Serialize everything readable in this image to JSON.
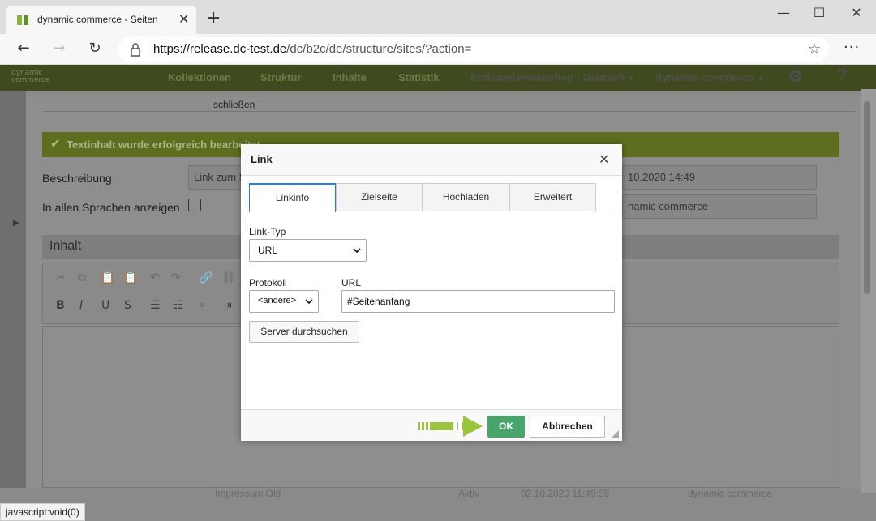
{
  "browser": {
    "tab_title": "dynamic commerce - Seiten",
    "close_glyph": "✕",
    "new_tab_glyph": "+",
    "url_host": "https://release.dc-test.de",
    "url_path": "/dc/b2c/de/structure/sites/?action=",
    "minimize_glyph": "—",
    "maximize_glyph": "☐",
    "close_window_glyph": "✕",
    "back_glyph": "←",
    "forward_glyph": "→",
    "reload_glyph": "↻",
    "star_glyph": "☆",
    "menu_glyph": "···"
  },
  "app_nav": {
    "logo_line1": "dynamic",
    "logo_line2": "commerce",
    "items": [
      "Kollektionen",
      "Struktur",
      "Inhalte",
      "Statistik"
    ],
    "shop_select": "Endkundenwebshop - Deutsch",
    "user_select": "dynamic commerce",
    "dropdown_glyph": "▼",
    "gear_glyph": "⚙",
    "help_glyph": "?"
  },
  "background_form": {
    "close_link": "schließen",
    "success_message": "Textinhalt wurde erfolgreich bearbeitet",
    "check_glyph": "✔",
    "description_label": "Beschreibung",
    "description_value": "Link zum S",
    "all_languages_label": "In allen Sprachen anzeigen",
    "date_value": "10.2020 14:49",
    "company_value": "namic commerce",
    "content_header": "Inhalt",
    "bottom_row": {
      "name": "Impressum Old",
      "status": "Aktiv",
      "date": "02.10.2020 11:49:59",
      "owner": "dynamic commerce"
    }
  },
  "status_bar": "javascript:void(0)",
  "dialog": {
    "title": "Link",
    "close_glyph": "✕",
    "tabs": [
      "Linkinfo",
      "Zielseite",
      "Hochladen",
      "Erweitert"
    ],
    "link_type_label": "Link-Typ",
    "link_type_value": "URL",
    "protocol_label": "Protokoll",
    "protocol_value": "<andere>",
    "url_label": "URL",
    "url_value": "#Seitenanfang",
    "browse_button": "Server durchsuchen",
    "ok_button": "OK",
    "cancel_button": "Abbrechen"
  },
  "colors": {
    "accent_green": "#48a56c",
    "tab_active_border": "#2a7fd4",
    "success_bar": "#5d6e1e",
    "annotation_arrow": "#9bc53d"
  }
}
